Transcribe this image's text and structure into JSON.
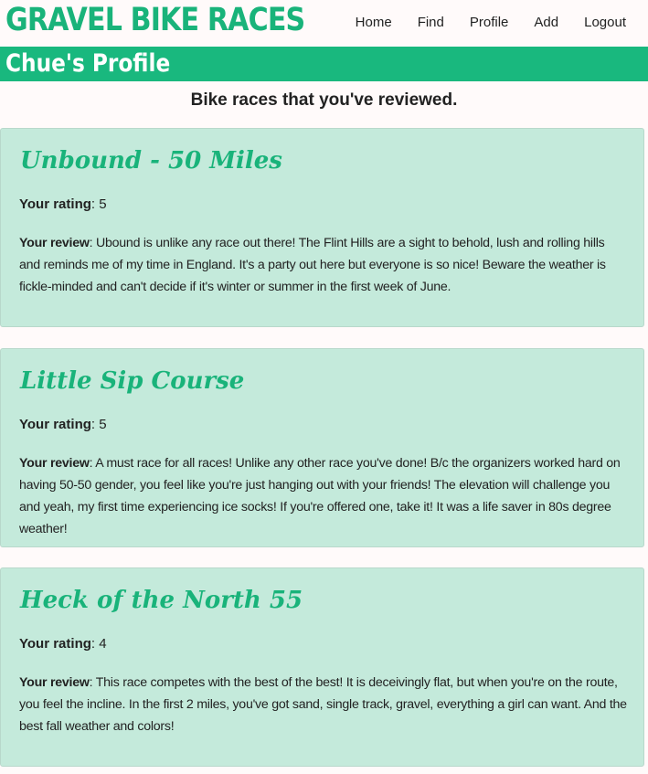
{
  "header": {
    "site_title": "GRAVEL BIKE RACES",
    "nav": [
      {
        "label": "Home"
      },
      {
        "label": "Find"
      },
      {
        "label": "Profile"
      },
      {
        "label": "Add"
      },
      {
        "label": "Logout"
      }
    ]
  },
  "profile": {
    "title": "Chue's Profile",
    "subheading": "Bike races that you've reviewed."
  },
  "labels": {
    "rating": "Your rating",
    "review": "Your review"
  },
  "reviews": [
    {
      "race": "Unbound - 50 Miles",
      "rating": ": 5",
      "review": ": Ubound is unlike any race out there! The Flint Hills are a sight to behold, lush and rolling hills and reminds me of my time in England. It's a party out here but everyone is so nice! Beware the weather is fickle-minded and can't decide if it's winter or summer in the first week of June."
    },
    {
      "race": "Little Sip Course",
      "rating": ": 5",
      "review": ": A must race for all races! Unlike any other race you've done! B/c the organizers worked hard on having 50-50 gender, you feel like you're just hanging out with your friends! The elevation will challenge you and yeah, my first time experiencing ice socks! If you're offered one, take it! It was a life saver in 80s degree weather!"
    },
    {
      "race": "Heck of the North 55",
      "rating": ": 4",
      "review": ": This race competes with the best of the best! It is deceivingly flat, but when you're on the route, you feel the incline. In the first 2 miles, you've got sand, single track, gravel, everything a girl can want. And the best fall weather and colors!"
    }
  ],
  "colors": {
    "brand": "#19b37a",
    "profile_bar": "#19b87e",
    "card": "#c4eadb",
    "page": "#fffafa"
  }
}
